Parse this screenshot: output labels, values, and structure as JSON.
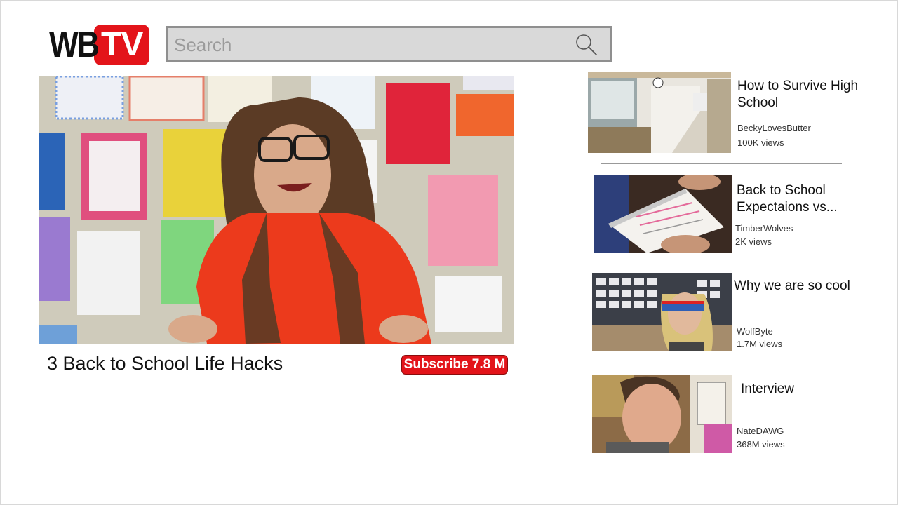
{
  "brand": {
    "logo_left": "WB",
    "logo_right": "TV",
    "accent": "#e3141a"
  },
  "search": {
    "placeholder": "Search",
    "value": ""
  },
  "main_video": {
    "title": "3 Back to School Life Hacks",
    "subscribe_label": "Subscribe 7.8 M"
  },
  "recommendations": [
    {
      "title": "How to Survive High School",
      "channel": "BeckyLovesButter",
      "views": "100K views"
    },
    {
      "title": "Back to School Expectaions vs...",
      "channel": "TimberWolves",
      "views": "2K views"
    },
    {
      "title": "Why we are so cool",
      "channel": "WolfByte",
      "views": "1.7M views"
    },
    {
      "title": "Interview",
      "channel": "NateDAWG",
      "views": "368M views"
    }
  ],
  "icons": {
    "search": "search-icon"
  }
}
